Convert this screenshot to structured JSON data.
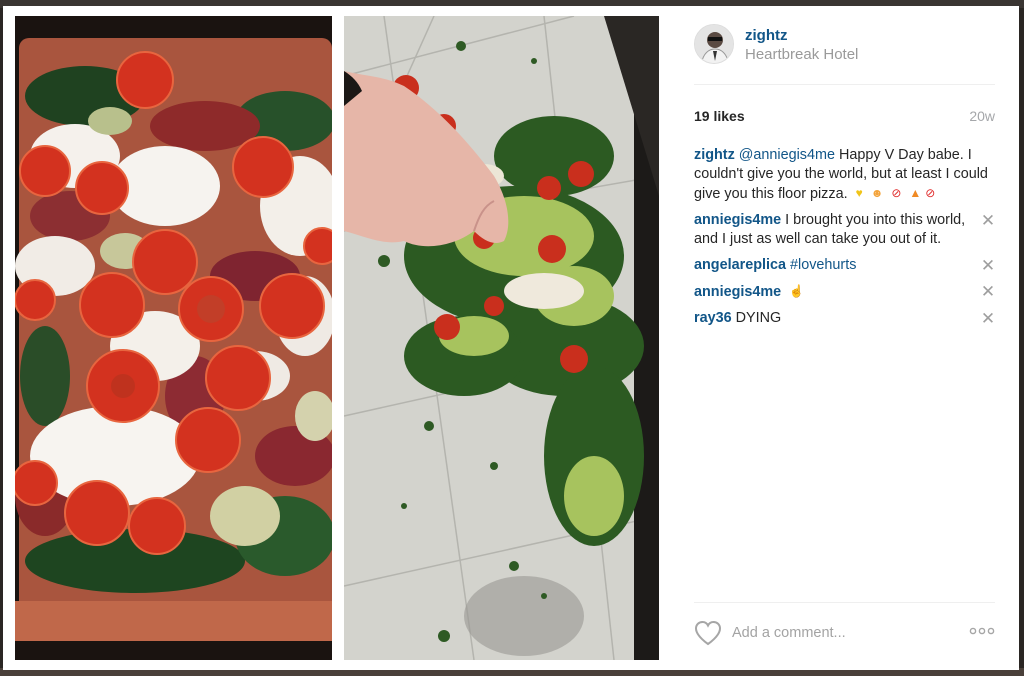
{
  "colors": {
    "link_blue": "#125688",
    "muted_gray": "#9a9a9a",
    "divider": "#efefef"
  },
  "post": {
    "photo_alt_left": "pizza with tomatoes, mozzarella and pesto",
    "photo_alt_right": "pizza spilled on tiled floor with a hand",
    "user": {
      "username": "zightz",
      "location": "Heartbreak Hotel",
      "avatar_icon": "avatar-photo"
    },
    "likes": "19 likes",
    "time": "20w",
    "caption": {
      "author": "zightz",
      "mention": "@anniegis4me",
      "text": " Happy V Day babe. I couldn't give you the world, but at least I could give you this floor pizza.",
      "emojis": [
        "yellow-heart-icon",
        "kiss-face-icon",
        "no-entry-icon",
        "pizza-icon",
        "no-entry-icon"
      ]
    },
    "comments": [
      {
        "author": "anniegis4me",
        "text": " I brought you into this world, and I just as well can take you out of it.",
        "hashtag": ""
      },
      {
        "author": "angelareplica",
        "text": " ",
        "hashtag": "#lovehurts"
      },
      {
        "author": "anniegis4me",
        "text": " ",
        "hashtag": "",
        "emoji": "pointing-hand-icon"
      },
      {
        "author": "ray36",
        "text": " DYING",
        "hashtag": ""
      }
    ],
    "footer": {
      "like_icon": "heart-outline-icon",
      "comment_placeholder": "Add a comment...",
      "more_icon": "more-options-icon"
    }
  }
}
